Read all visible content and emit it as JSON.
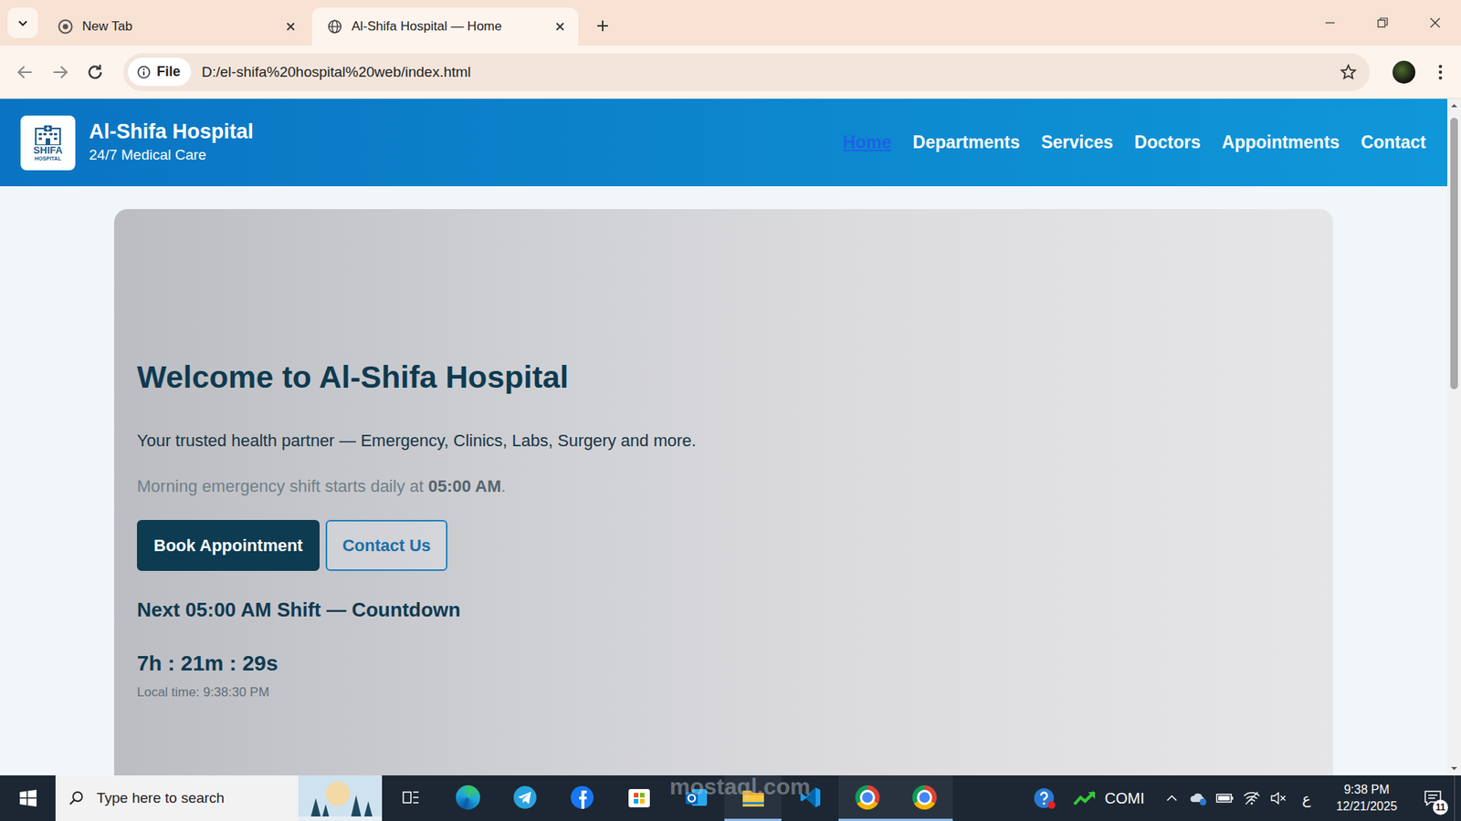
{
  "browser": {
    "tabs": [
      {
        "label": "New Tab",
        "selected": false
      },
      {
        "label": "Al-Shifa Hospital — Home",
        "selected": true
      }
    ],
    "address": {
      "chip": "File",
      "url": "D:/el-shifa%20hospital%20web/index.html"
    }
  },
  "site": {
    "logo": {
      "line1": "SHIFA",
      "line2": "HOSPITAL"
    },
    "title": "Al-Shifa Hospital",
    "subtitle": "24/7 Medical Care",
    "nav": [
      {
        "label": "Home",
        "selected": true
      },
      {
        "label": "Departments",
        "selected": false
      },
      {
        "label": "Services",
        "selected": false
      },
      {
        "label": "Doctors",
        "selected": false
      },
      {
        "label": "Appointments",
        "selected": false
      },
      {
        "label": "Contact",
        "selected": false
      }
    ]
  },
  "hero": {
    "title": "Welcome to Al-Shifa Hospital",
    "subtitle": "Your trusted health partner — Emergency, Clinics, Labs, Surgery and more.",
    "shift": {
      "before": "Morning emergency shift starts daily at ",
      "time": "05:00 AM",
      "after": "."
    },
    "buttons": [
      {
        "label": "Book Appointment",
        "kind": "primary"
      },
      {
        "label": "Contact Us",
        "kind": "outline"
      }
    ],
    "countdown": {
      "heading": "Next 05:00 AM Shift — Countdown",
      "value": "7h : 21m : 29s",
      "local": "Local time: 9:38:30 PM"
    }
  },
  "taskbar": {
    "search": "Type here to search",
    "apps": [
      {
        "kind": "taskview",
        "running": false
      },
      {
        "kind": "edge",
        "running": false
      },
      {
        "kind": "telegram",
        "running": false
      },
      {
        "kind": "facebook",
        "running": false
      },
      {
        "kind": "store",
        "running": false
      },
      {
        "kind": "outlook",
        "running": false
      },
      {
        "kind": "explorer",
        "running": true
      },
      {
        "kind": "vscode",
        "running": false
      },
      {
        "kind": "chrome",
        "running": true
      },
      {
        "kind": "chrome",
        "running": true
      }
    ],
    "tray_label": "COMI",
    "language": "ع",
    "time": "9:38 PM",
    "date": "12/21/2025",
    "notifications": "11"
  },
  "watermark": "mostaql.com"
}
